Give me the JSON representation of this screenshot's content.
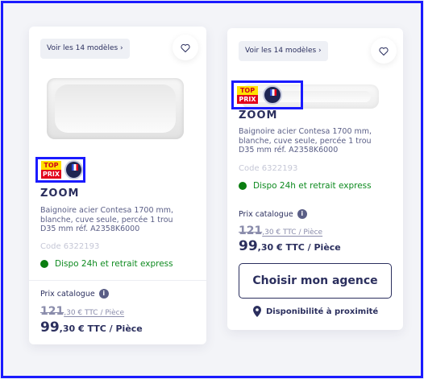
{
  "products": [
    {
      "models_label": "Voir les 14 modèles ›",
      "badge_top": "TOP",
      "badge_prix": "PRIX",
      "brand": "ZOOM",
      "description": "Baignoire acier Contesa 1700 mm, blanche, cuve seule, percée 1 trou D35 mm réf. A2358K6000",
      "code": "Code 6322193",
      "availability": "Dispo 24h et retrait express",
      "catalog_label": "Prix catalogue",
      "old_price_int": "121",
      "old_price_rest": ",30 € TTC / Pièce",
      "price_int": "99",
      "price_rest": ",30 € TTC / Pièce"
    },
    {
      "models_label": "Voir les 14 modèles ›",
      "badge_top": "TOP",
      "badge_prix": "PRIX",
      "brand": "ZOOM",
      "description": "Baignoire acier Contesa 1700 mm, blanche, cuve seule, percée 1 trou D35 mm réf. A2358K6000",
      "code": "Code 6322193",
      "availability": "Dispo 24h et retrait express",
      "catalog_label": "Prix catalogue",
      "old_price_int": "121",
      "old_price_rest": ",30 € TTC / Pièce",
      "price_int": "99",
      "price_rest": ",30 € TTC / Pièce",
      "cta_label": "Choisir mon agence",
      "nearby_label": "Disponibilité à proximité"
    }
  ],
  "info_glyph": "i"
}
